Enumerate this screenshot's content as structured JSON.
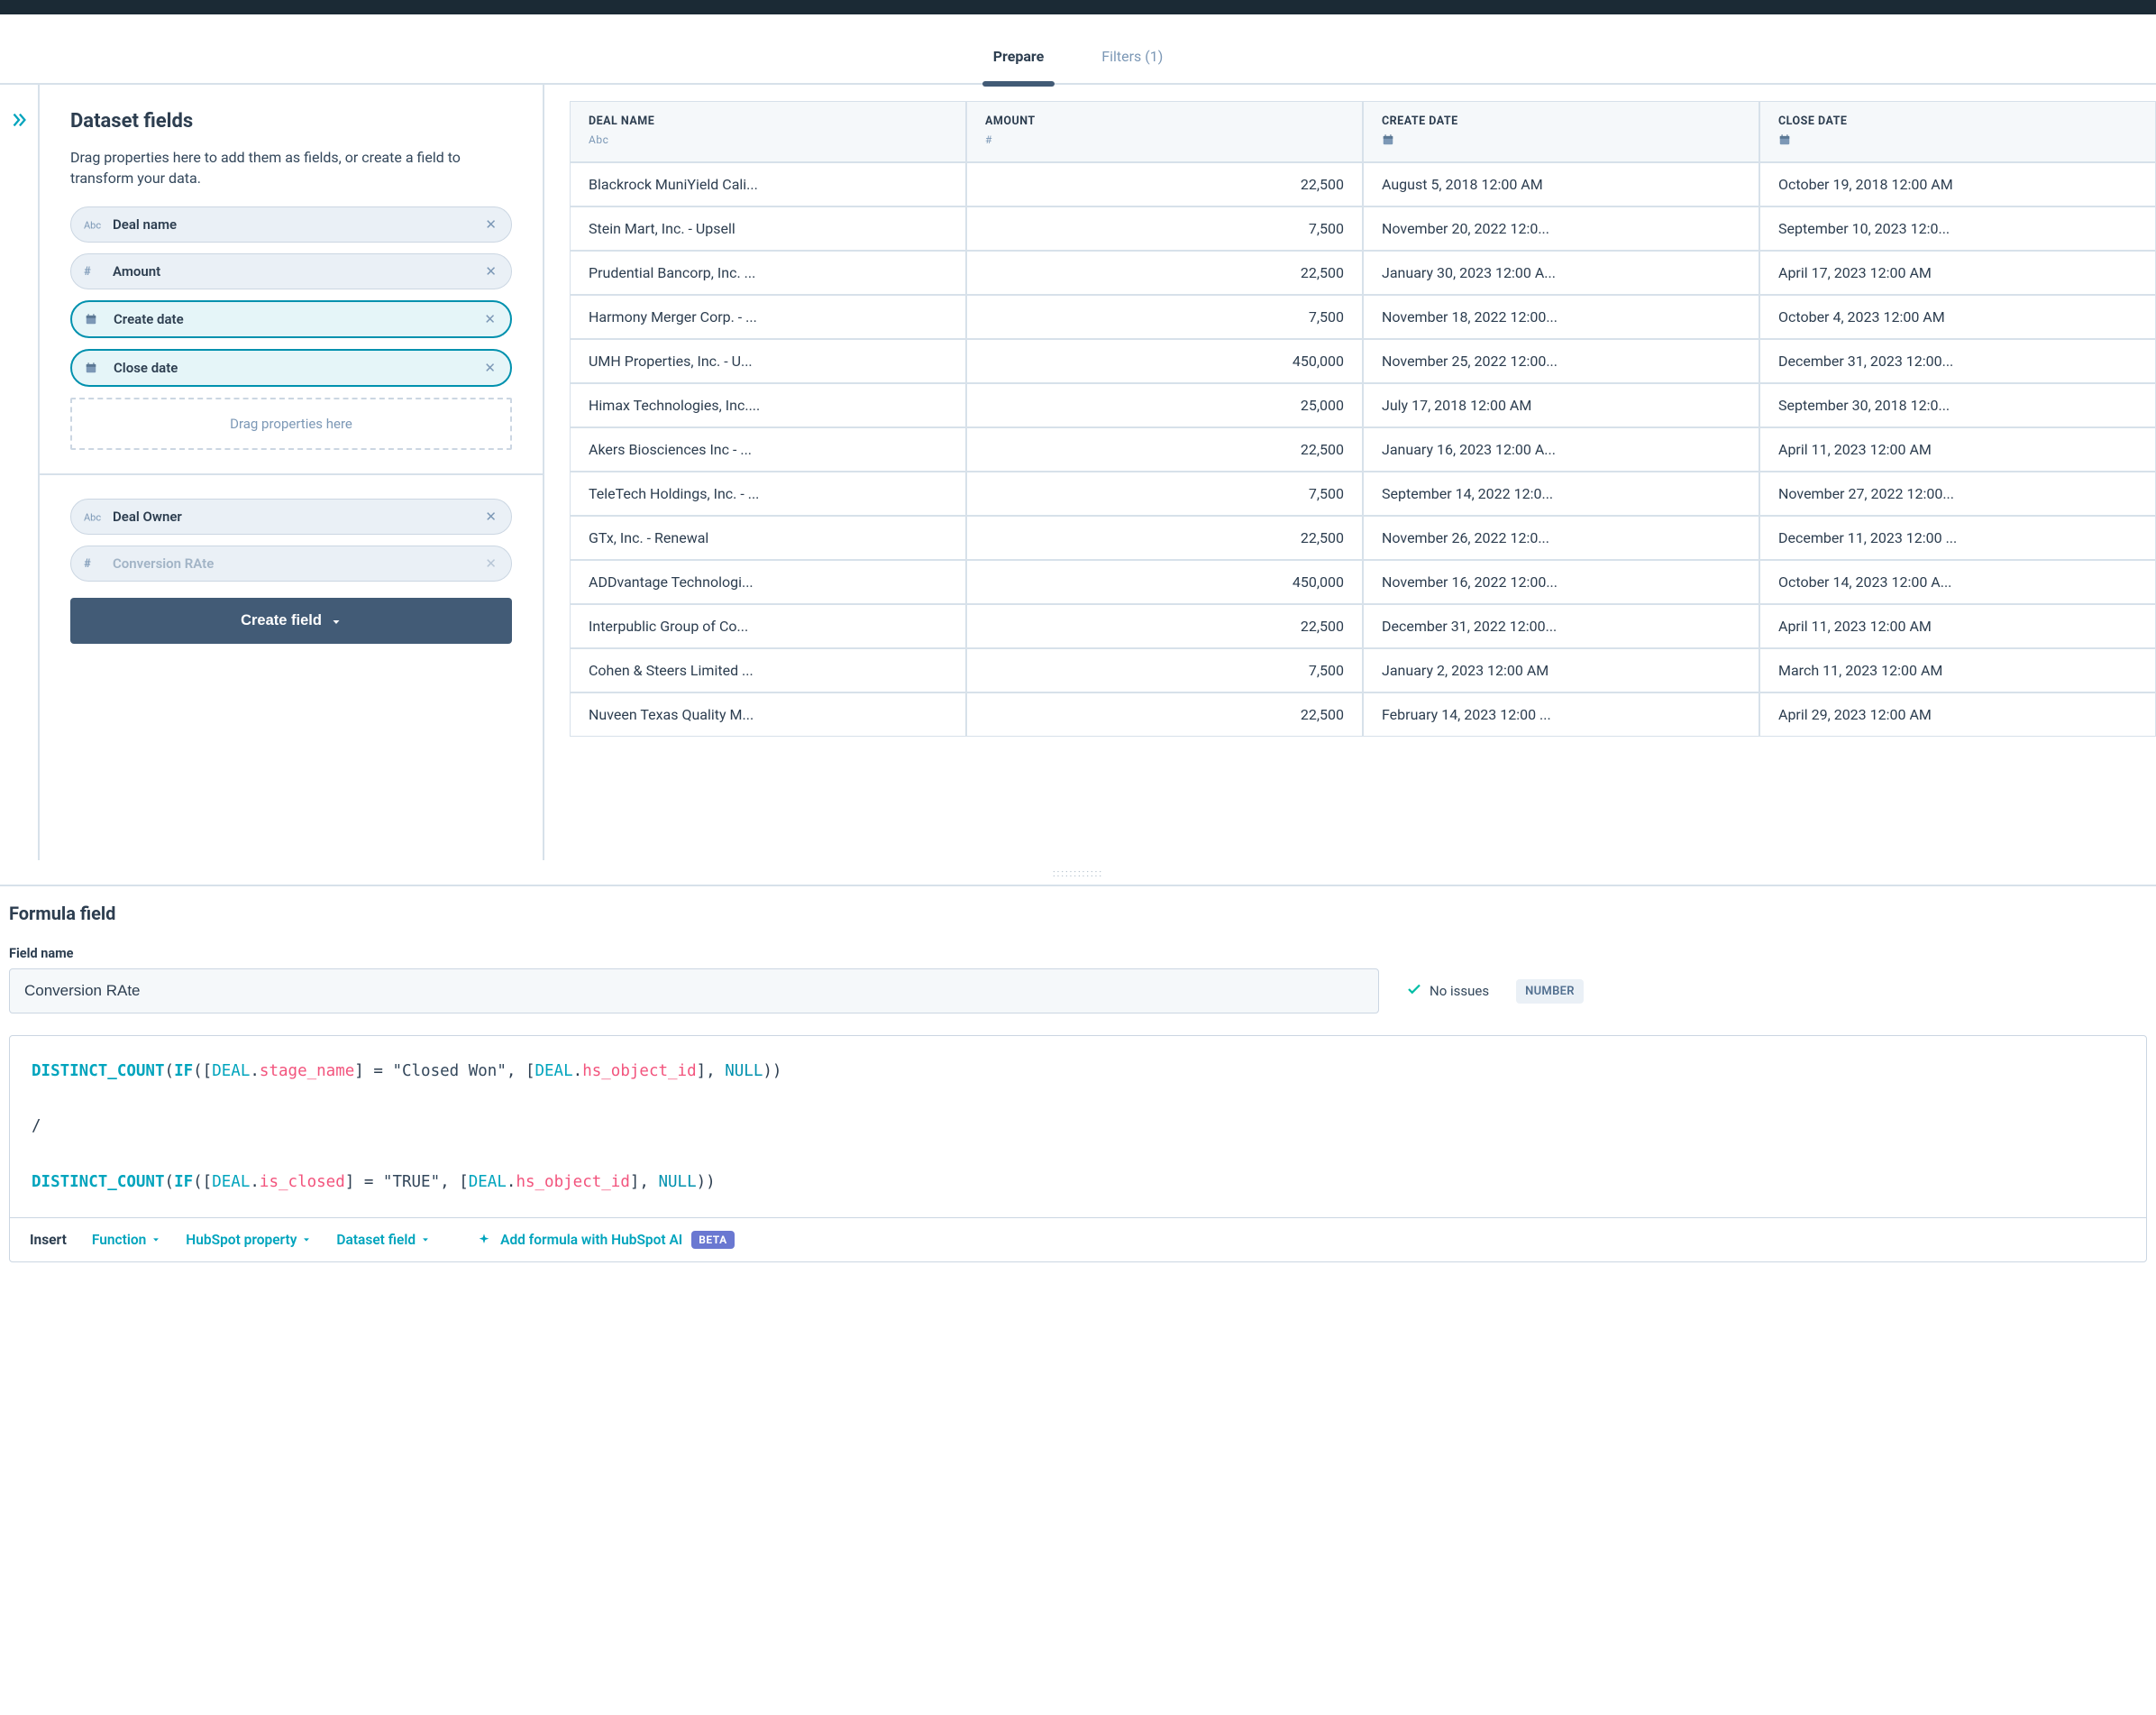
{
  "tabs": {
    "prepare": "Prepare",
    "filters": "Filters (1)"
  },
  "sidebar": {
    "title": "Dataset fields",
    "help": "Drag properties here to add them as fields, or create a field to transform your data.",
    "dropzone": "Drag properties here",
    "create_label": "Create field",
    "fields": [
      {
        "label": "Deal name",
        "type": "abc"
      },
      {
        "label": "Amount",
        "type": "num"
      },
      {
        "label": "Create date",
        "type": "date"
      },
      {
        "label": "Close date",
        "type": "date"
      }
    ],
    "extra_fields": [
      {
        "label": "Deal Owner",
        "type": "abc"
      },
      {
        "label": "Conversion RAte",
        "type": "num",
        "disabled": true
      }
    ]
  },
  "table": {
    "headers": [
      {
        "label": "DEAL NAME",
        "sub": "Abc"
      },
      {
        "label": "AMOUNT",
        "sub": "#"
      },
      {
        "label": "CREATE DATE",
        "sub": "cal"
      },
      {
        "label": "CLOSE DATE",
        "sub": "cal"
      }
    ],
    "rows": [
      {
        "name": "Blackrock MuniYield Cali...",
        "amount": "22,500",
        "create": "August 5, 2018 12:00 AM",
        "close": "October 19, 2018 12:00 AM"
      },
      {
        "name": "Stein Mart, Inc. - Upsell",
        "amount": "7,500",
        "create": "November 20, 2022 12:0...",
        "close": "September 10, 2023 12:0..."
      },
      {
        "name": "Prudential Bancorp, Inc. ...",
        "amount": "22,500",
        "create": "January 30, 2023 12:00 A...",
        "close": "April 17, 2023 12:00 AM"
      },
      {
        "name": "Harmony Merger Corp. - ...",
        "amount": "7,500",
        "create": "November 18, 2022 12:00...",
        "close": "October 4, 2023 12:00 AM"
      },
      {
        "name": "UMH Properties, Inc. - U...",
        "amount": "450,000",
        "create": "November 25, 2022 12:00...",
        "close": "December 31, 2023 12:00..."
      },
      {
        "name": "Himax Technologies, Inc....",
        "amount": "25,000",
        "create": "July 17, 2018 12:00 AM",
        "close": "September 30, 2018 12:0..."
      },
      {
        "name": "Akers Biosciences Inc - ...",
        "amount": "22,500",
        "create": "January 16, 2023 12:00 A...",
        "close": "April 11, 2023 12:00 AM"
      },
      {
        "name": "TeleTech Holdings, Inc. - ...",
        "amount": "7,500",
        "create": "September 14, 2022 12:0...",
        "close": "November 27, 2022 12:00..."
      },
      {
        "name": "GTx, Inc. - Renewal",
        "amount": "22,500",
        "create": "November 26, 2022 12:0...",
        "close": "December 11, 2023 12:00 ..."
      },
      {
        "name": "ADDvantage Technologi...",
        "amount": "450,000",
        "create": "November 16, 2022 12:00...",
        "close": "October 14, 2023 12:00 A..."
      },
      {
        "name": "Interpublic Group of Co...",
        "amount": "22,500",
        "create": "December 31, 2022 12:00...",
        "close": "April 11, 2023 12:00 AM"
      },
      {
        "name": "Cohen & Steers Limited ...",
        "amount": "7,500",
        "create": "January 2, 2023 12:00 AM",
        "close": "March 11, 2023 12:00 AM"
      },
      {
        "name": "Nuveen Texas Quality M...",
        "amount": "22,500",
        "create": "February 14, 2023 12:00 ...",
        "close": "April 29, 2023 12:00 AM"
      }
    ]
  },
  "formula": {
    "panel_title": "Formula field",
    "name_label": "Field name",
    "name_value": "Conversion RAte",
    "no_issues": "No issues",
    "type_badge": "NUMBER",
    "insert_label": "Insert",
    "insert_function": "Function",
    "insert_hs_prop": "HubSpot property",
    "insert_ds_field": "Dataset field",
    "ai_label": "Add formula with HubSpot AI",
    "beta": "BETA",
    "code_tokens": [
      {
        "type": "fn",
        "t": "DISTINCT_COUNT"
      },
      {
        "type": "p",
        "t": "("
      },
      {
        "type": "fn",
        "t": "IF"
      },
      {
        "type": "p",
        "t": "(["
      },
      {
        "type": "scope",
        "t": "DEAL"
      },
      {
        "type": "p",
        "t": "."
      },
      {
        "type": "prop",
        "t": "stage_name"
      },
      {
        "type": "p",
        "t": "] = "
      },
      {
        "type": "str",
        "t": "\"Closed Won\""
      },
      {
        "type": "p",
        "t": ", ["
      },
      {
        "type": "scope",
        "t": "DEAL"
      },
      {
        "type": "p",
        "t": "."
      },
      {
        "type": "prop",
        "t": "hs_object_id"
      },
      {
        "type": "p",
        "t": "], "
      },
      {
        "type": "null",
        "t": "NULL"
      },
      {
        "type": "p",
        "t": "))"
      },
      {
        "type": "br"
      },
      {
        "type": "br"
      },
      {
        "type": "p",
        "t": "/"
      },
      {
        "type": "br"
      },
      {
        "type": "br"
      },
      {
        "type": "fn",
        "t": "DISTINCT_COUNT"
      },
      {
        "type": "p",
        "t": "("
      },
      {
        "type": "fn",
        "t": "IF"
      },
      {
        "type": "p",
        "t": "(["
      },
      {
        "type": "scope",
        "t": "DEAL"
      },
      {
        "type": "p",
        "t": "."
      },
      {
        "type": "prop",
        "t": "is_closed"
      },
      {
        "type": "p",
        "t": "] = "
      },
      {
        "type": "str",
        "t": "\"TRUE\""
      },
      {
        "type": "p",
        "t": ", ["
      },
      {
        "type": "scope",
        "t": "DEAL"
      },
      {
        "type": "p",
        "t": "."
      },
      {
        "type": "prop",
        "t": "hs_object_id"
      },
      {
        "type": "p",
        "t": "], "
      },
      {
        "type": "null",
        "t": "NULL"
      },
      {
        "type": "p",
        "t": "))"
      }
    ]
  }
}
